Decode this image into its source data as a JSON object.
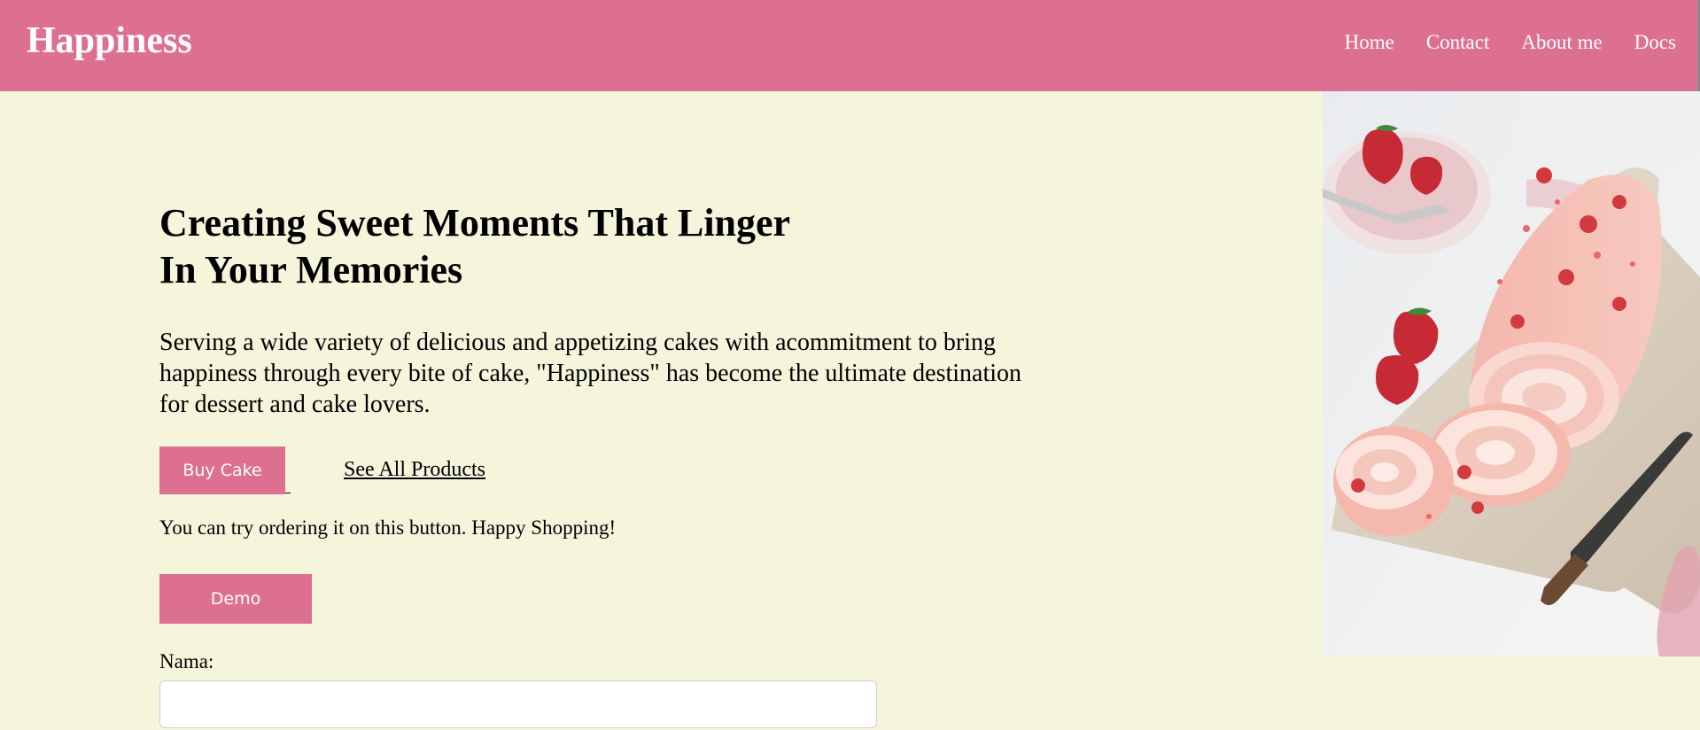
{
  "header": {
    "brand": "Happiness",
    "nav": [
      "Home",
      "Contact",
      "About me",
      "Docs"
    ]
  },
  "hero": {
    "headline_line1": "Creating Sweet Moments That Linger",
    "headline_line2": "In Your Memories",
    "description_line1": "Serving a wide variety of delicious and appetizing cakes with acommitment to bring",
    "description_line2": "happiness through every bite of cake, \"Happiness\" has become the ultimate destination",
    "description_line3": "for dessert and cake lovers.",
    "buy_label": "Buy Cake",
    "see_all_label": "See All Products",
    "hint": "You can try ordering it on this button. Happy Shopping!",
    "demo_label": "Demo"
  },
  "form": {
    "name_label": "Nama:",
    "name_value": "",
    "name_placeholder": ""
  },
  "colors": {
    "accent": "#dd7091",
    "background": "#f5f5dc"
  },
  "image": {
    "icon": "strawberry-roll-cake-photo"
  }
}
